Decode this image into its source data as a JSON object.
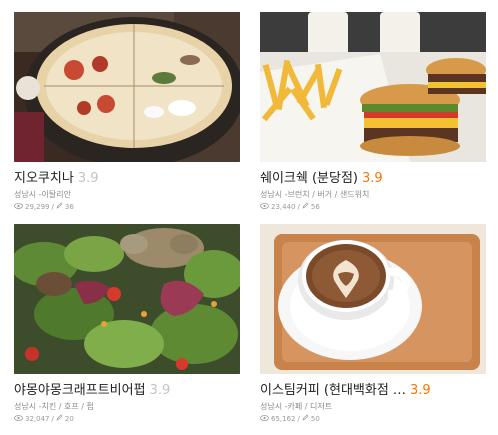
{
  "restaurants": [
    {
      "name": "지오쿠치나",
      "rating": "3.9",
      "rating_color": "#c3c3c3",
      "location": "성남시 -이탈리안",
      "views": "29,299",
      "reviews": "36",
      "image_icon": "pizza-photo"
    },
    {
      "name": "쉐이크쉑 (분당점)",
      "rating": "3.9",
      "rating_color": "#ff7100",
      "location": "성남시 -브런치 / 버거 / 샌드위치",
      "views": "23,440",
      "reviews": "56",
      "image_icon": "burger-fries-photo"
    },
    {
      "name": "야몽야몽크래프트비어펍",
      "rating": "3.9",
      "rating_color": "#c3c3c3",
      "location": "성남시 -치킨 / 호프 / 펍",
      "views": "32,047",
      "reviews": "20",
      "image_icon": "salad-photo"
    },
    {
      "name": "이스팀커피 (현대백화점 …",
      "rating": "3.9",
      "rating_color": "#ff7100",
      "location": "성남시 -카페 / 디저트",
      "views": "65,162",
      "reviews": "50",
      "image_icon": "latte-photo"
    }
  ]
}
